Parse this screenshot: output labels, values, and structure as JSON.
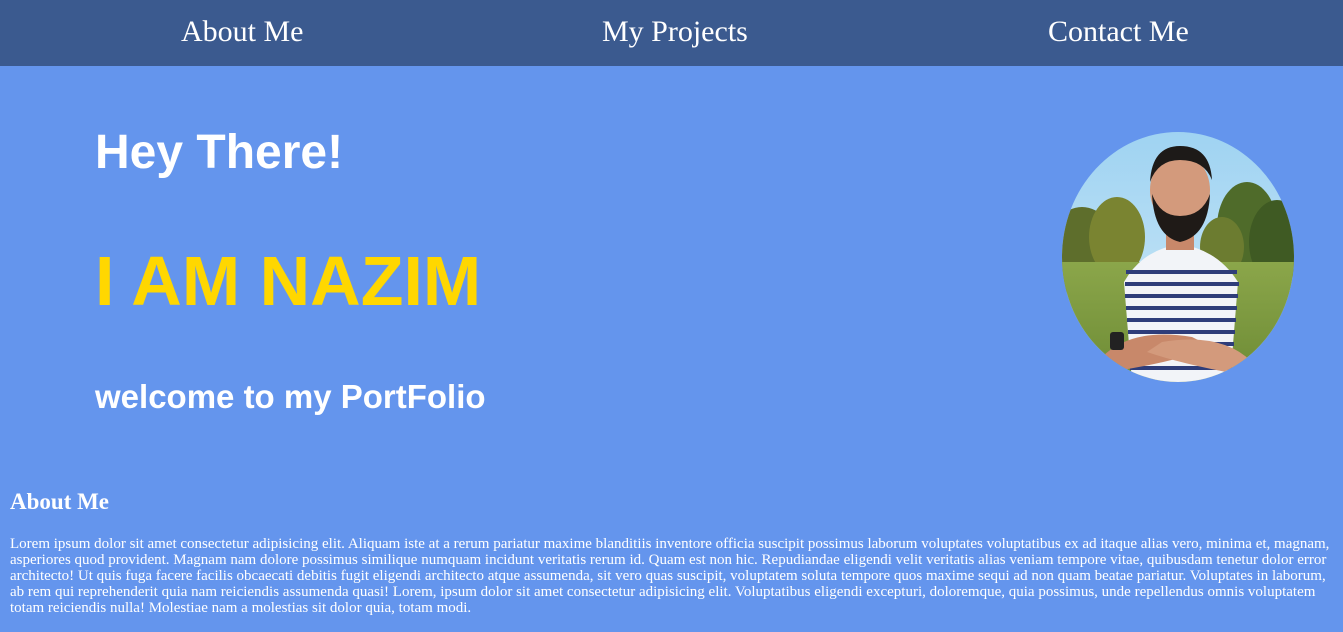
{
  "nav": {
    "items": [
      {
        "label": "About Me"
      },
      {
        "label": "My Projects"
      },
      {
        "label": "Contact Me"
      }
    ]
  },
  "hero": {
    "greeting": "Hey There!",
    "name": "I AM NAZIM",
    "welcome": "welcome to my PortFolio",
    "name_color": "#ffd700"
  },
  "about": {
    "heading": "About Me",
    "text": "Lorem ipsum dolor sit amet consectetur adipisicing elit. Aliquam iste at a rerum pariatur maxime blanditiis inventore officia suscipit possimus laborum voluptates voluptatibus ex ad itaque alias vero, minima et, magnam, asperiores quod provident. Magnam nam dolore possimus similique numquam incidunt veritatis rerum id. Quam est non hic. Repudiandae eligendi velit veritatis alias veniam tempore vitae, quibusdam tenetur dolor error architecto! Ut quis fuga facere facilis obcaecati debitis fugit eligendi architecto atque assumenda, sit vero quas suscipit, voluptatem soluta tempore quos maxime sequi ad non quam beatae pariatur. Voluptates in laborum, ab rem qui reprehenderit quia nam reiciendis assumenda quasi! Lorem, ipsum dolor sit amet consectetur adipisicing elit. Voluptatibus eligendi excepturi, doloremque, quia possimus, unde repellendus omnis voluptatem totam reiciendis nulla! Molestiae nam a molestias sit dolor quia, totam modi."
  },
  "colors": {
    "page_background": "#6495ed",
    "navbar_background": "#3b5a8f",
    "accent_name": "#ffd700"
  }
}
